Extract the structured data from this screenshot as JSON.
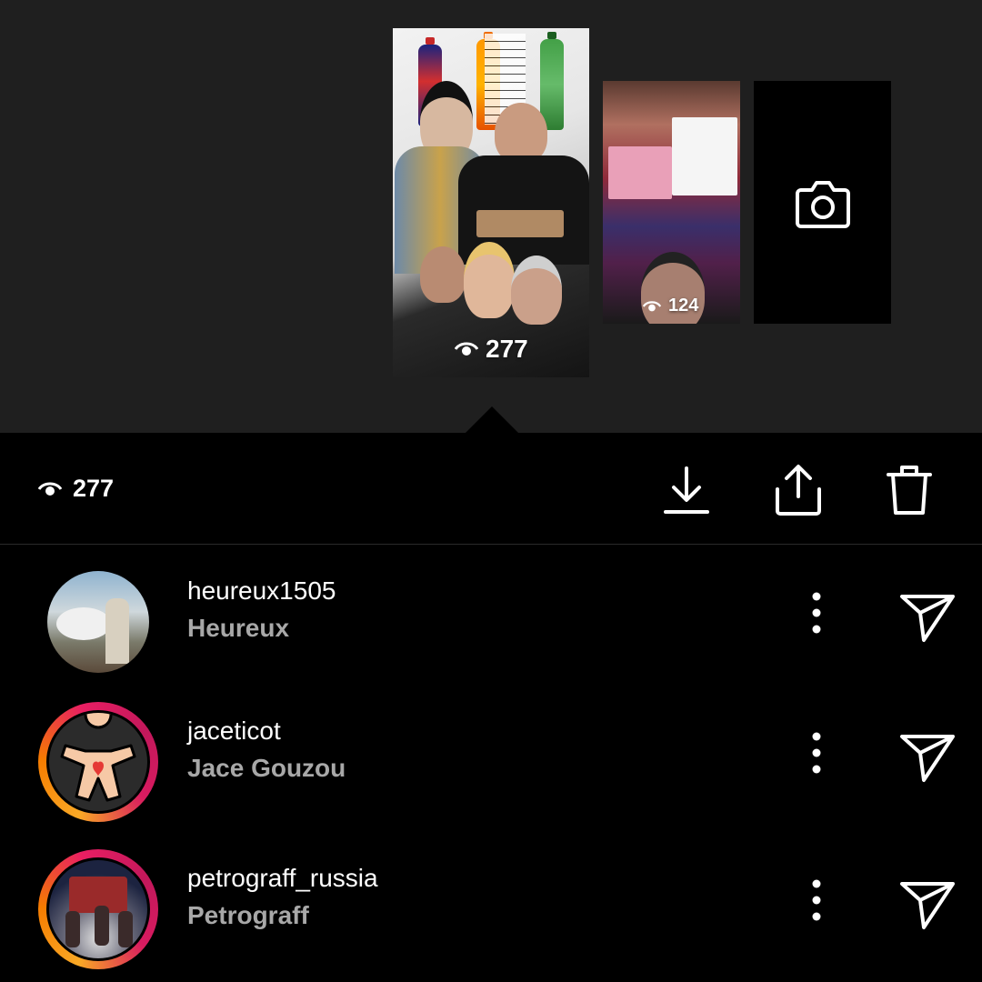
{
  "stories": [
    {
      "views": "277",
      "selected": true
    },
    {
      "views": "124",
      "selected": false
    }
  ],
  "add_story": {
    "icon": "camera-icon"
  },
  "toolbar": {
    "views": "277",
    "actions": [
      {
        "icon": "download-icon"
      },
      {
        "icon": "share-icon"
      },
      {
        "icon": "trash-icon"
      }
    ]
  },
  "viewers": [
    {
      "username": "heureux1505",
      "full_name": "Heureux",
      "story_ring": false
    },
    {
      "username": "jaceticot",
      "full_name": "Jace Gouzou",
      "story_ring": true
    },
    {
      "username": "petrograff_russia",
      "full_name": "Petrograff",
      "story_ring": true
    }
  ],
  "colors": {
    "background": "#000000",
    "top_area": "#1f1f1f",
    "secondary_text": "#a8a8a8",
    "ring_start": "#f9a825",
    "ring_end": "#d81b60"
  }
}
